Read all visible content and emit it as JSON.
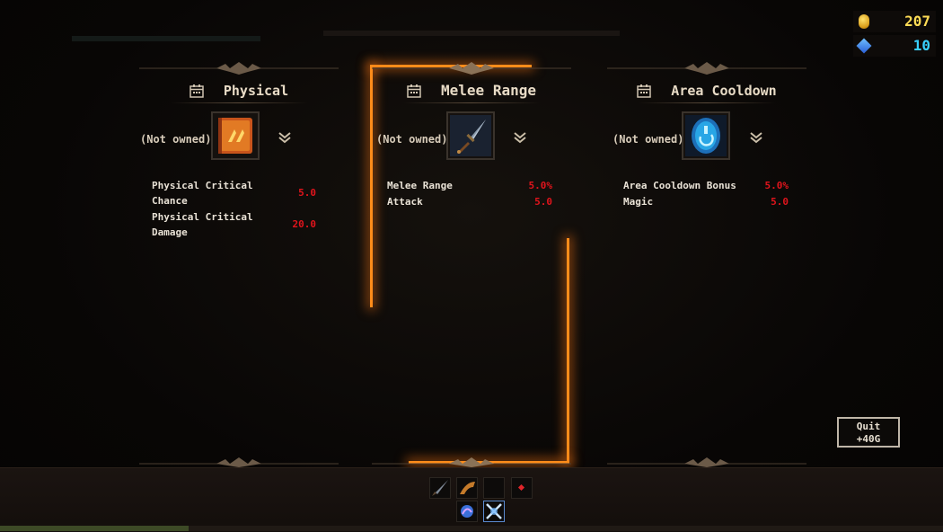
{
  "currency": {
    "gold": "207",
    "gems": "10",
    "gold_color": "#ffdc55",
    "gem_color": "#39d0ff",
    "gold_icon": "gold-coin-icon",
    "gem_icon": "blue-gem-icon"
  },
  "cards": [
    {
      "title": "Physical",
      "owned": "(Not owned)",
      "icon": "physical-tome-icon",
      "stats": [
        {
          "label": "Physical Critical\nChance",
          "value": "5.0"
        },
        {
          "label": "Physical Critical\nDamage",
          "value": "20.0"
        }
      ]
    },
    {
      "title": "Melee Range",
      "owned": "(Not owned)",
      "icon": "dagger-icon",
      "selected": true,
      "stats": [
        {
          "label": "Melee Range",
          "value": "5.0%"
        },
        {
          "label": "Attack",
          "value": "5.0"
        }
      ]
    },
    {
      "title": "Area Cooldown",
      "owned": "(Not owned)",
      "icon": "blue-rune-stone-icon",
      "stats": [
        {
          "label": "Area Cooldown Bonus",
          "value": "5.0%"
        },
        {
          "label": "Magic",
          "value": "5.0"
        }
      ]
    }
  ],
  "quit": {
    "line1": "Quit",
    "line2": "+40G"
  },
  "colors": {
    "accent": "#ff8c1a",
    "stat_value": "#e0141c",
    "text": "#e8dbc6"
  }
}
